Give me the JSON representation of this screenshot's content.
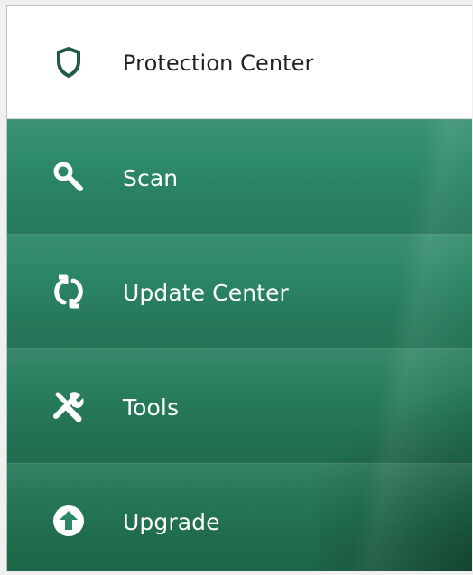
{
  "nav": {
    "items": [
      {
        "label": "Protection Center",
        "icon": "shield-icon",
        "active": true
      },
      {
        "label": "Scan",
        "icon": "search-icon",
        "active": false
      },
      {
        "label": "Update Center",
        "icon": "refresh-icon",
        "active": false
      },
      {
        "label": "Tools",
        "icon": "tools-icon",
        "active": false
      },
      {
        "label": "Upgrade",
        "icon": "upgrade-arrow-icon",
        "active": false
      }
    ]
  },
  "colors": {
    "accent_green": "#2b8766",
    "active_icon_green": "#1e5a47",
    "active_background": "#ffffff",
    "text_dark": "#202425",
    "text_light": "#ffffff"
  }
}
